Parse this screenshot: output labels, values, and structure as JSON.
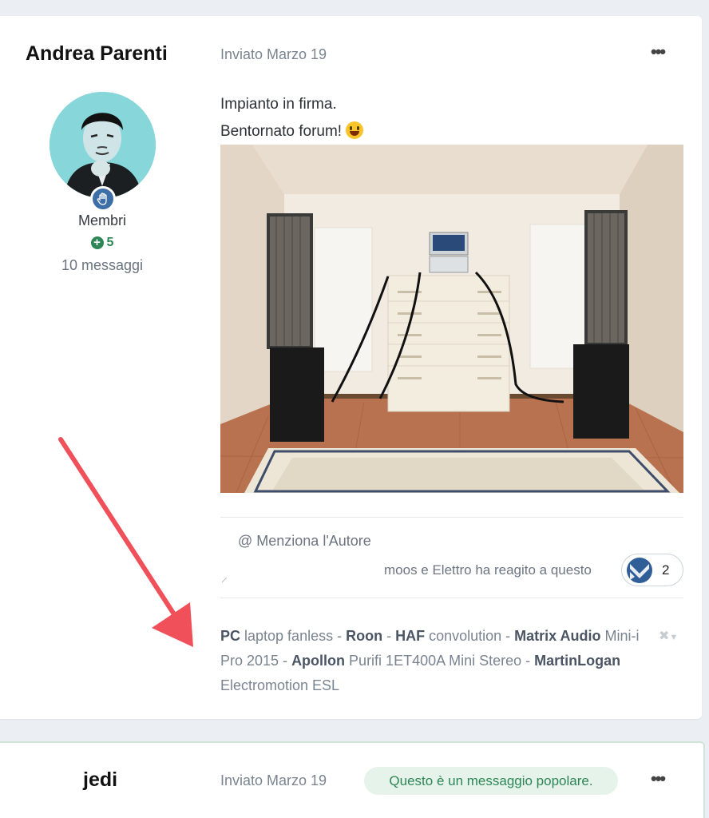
{
  "posts": [
    {
      "author": "Andrea Parenti",
      "group": "Membri",
      "reputation": "5",
      "messages": "10 messaggi",
      "date": "Inviato Marzo 19",
      "more_icon": "ellipsis-icon",
      "content": [
        "Impianto in firma.",
        "Bentornato forum!"
      ],
      "mention_label": "@ Menziona l'Autore",
      "reactions_text": "moos e Elettro ha reagito a questo",
      "reaction_count": "2",
      "signature": {
        "s1": "PC",
        "t1": " laptop fanless - ",
        "s2": "Roon",
        "t2": " - ",
        "s3": "HAF",
        "t3": " convolution - ",
        "s4": "Matrix Audio",
        "t4": " Mini-i Pro 2015 - ",
        "s5": "Apollon",
        "t5": " Purifi 1ET400A Mini Stereo - ",
        "s6": "MartinLogan",
        "t6": " Electromotion ESL"
      }
    },
    {
      "author": "jedi",
      "date": "Inviato Marzo 19",
      "popular_badge": "Questo è un messaggio popolare.",
      "more_icon": "ellipsis-icon"
    }
  ],
  "colors": {
    "accent_green": "#2d8656",
    "annotation_arrow": "#f0505a",
    "badge_blue": "#3d6ea8"
  }
}
